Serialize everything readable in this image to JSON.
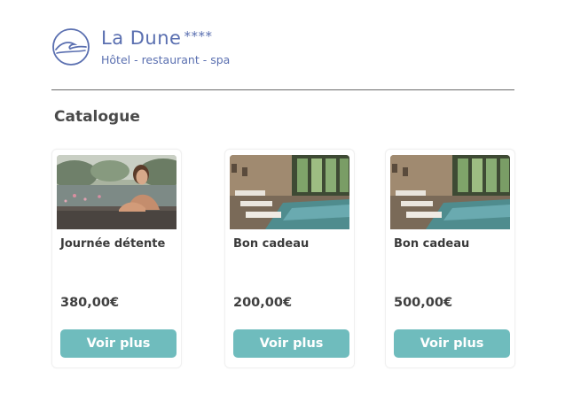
{
  "brand": {
    "name": "La Dune",
    "stars": "****",
    "subtitle": "Hôtel - restaurant - spa",
    "color": "#5a6fb0"
  },
  "catalogue": {
    "title": "Catalogue",
    "button_color": "#6fbcbd",
    "items": [
      {
        "name": "Journée détente",
        "price": "380,00€",
        "button": "Voir plus",
        "image": "woman-in-outdoor-pool"
      },
      {
        "name": "Bon cadeau",
        "price": "200,00€",
        "button": "Voir plus",
        "image": "indoor-spa-pool"
      },
      {
        "name": "Bon cadeau",
        "price": "500,00€",
        "button": "Voir plus",
        "image": "indoor-spa-pool"
      }
    ]
  }
}
